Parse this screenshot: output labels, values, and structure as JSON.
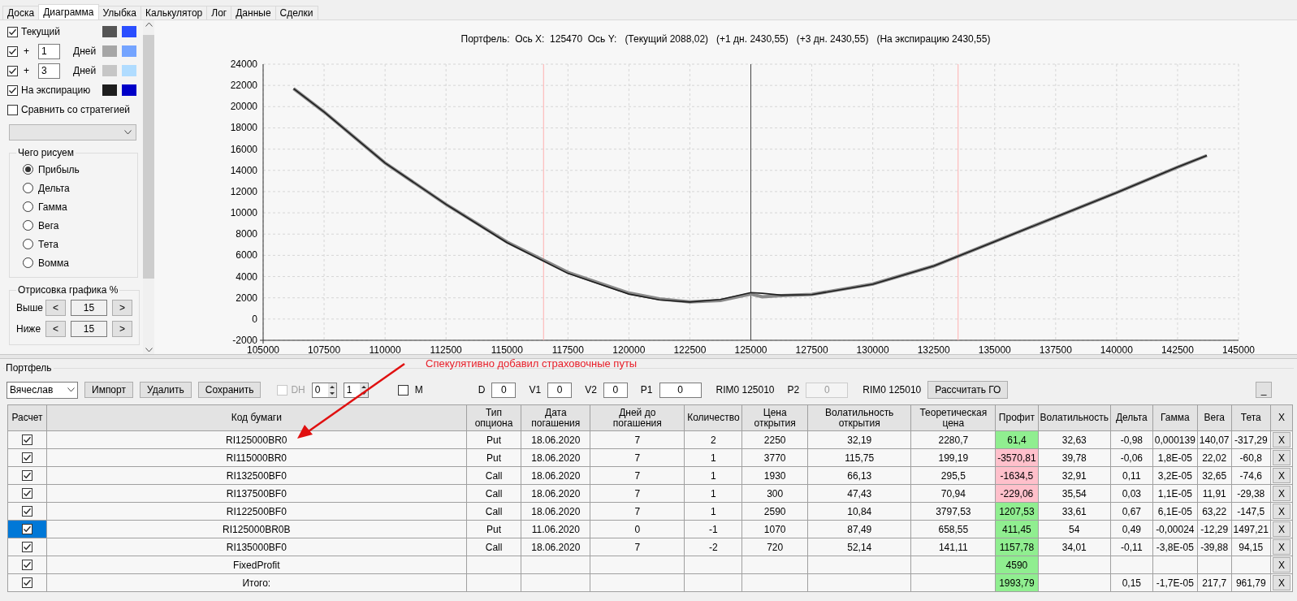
{
  "tabs": [
    {
      "label": "Доска",
      "selected": false
    },
    {
      "label": "Диаграмма",
      "selected": true
    },
    {
      "label": "Улыбка",
      "selected": false
    },
    {
      "label": "Калькулятор",
      "selected": false
    },
    {
      "label": "Лог",
      "selected": false
    },
    {
      "label": "Данные",
      "selected": false
    },
    {
      "label": "Сделки",
      "selected": false
    }
  ],
  "panel": {
    "curves": [
      {
        "kind": "label",
        "checked": true,
        "label": "Текущий",
        "swatches": [
          {
            "color": "#555555"
          },
          {
            "color": "#2a4eff"
          }
        ]
      },
      {
        "kind": "days",
        "checked": true,
        "prefix": "+",
        "days": "1",
        "unit": "Дней",
        "swatches": [
          {
            "color": "#a6a6a6"
          },
          {
            "color": "#74a4ff"
          }
        ]
      },
      {
        "kind": "days",
        "checked": true,
        "prefix": "+",
        "days": "3",
        "unit": "Дней",
        "swatches": [
          {
            "color": "#c6c6c6"
          },
          {
            "color": "#b0dcff"
          }
        ]
      },
      {
        "kind": "label",
        "checked": true,
        "label": "На экспирацию",
        "swatches": [
          {
            "color": "#1e1e1e"
          },
          {
            "color": "#0000c8"
          }
        ]
      }
    ],
    "compare": {
      "label": "Сравнить со стратегией",
      "checked": false
    },
    "plot_mode": {
      "title": "Чего рисуем",
      "options": [
        {
          "label": "Прибыль",
          "selected": true
        },
        {
          "label": "Дельта",
          "selected": false
        },
        {
          "label": "Гамма",
          "selected": false
        },
        {
          "label": "Вега",
          "selected": false
        },
        {
          "label": "Тета",
          "selected": false
        },
        {
          "label": "Вомма",
          "selected": false
        }
      ]
    },
    "range": {
      "title": "Отрисовка графика %",
      "rows": [
        {
          "label": "Выше",
          "prev": "<",
          "value": "15",
          "next": ">"
        },
        {
          "label": "Ниже",
          "prev": "<",
          "value": "15",
          "next": ">"
        }
      ]
    }
  },
  "chart": {
    "chart_data": {
      "type": "line",
      "title": "Портфель:  Ось X:  125470  Ось Y:   (Текущий 2088,02)   (+1 дн. 2430,55)   (+3 дн. 2430,55)   (На экспирацию 2430,55)",
      "x": [
        106250,
        107500,
        110000,
        112500,
        115000,
        117500,
        120000,
        121250,
        122500,
        123750,
        125000,
        125470,
        126250,
        127500,
        130000,
        132500,
        135000,
        137500,
        140000,
        142500,
        143700
      ],
      "grid": true,
      "series": [
        {
          "color": "#8a8a8a",
          "values": [
            21700,
            19500,
            14700,
            10800,
            7250,
            4400,
            2450,
            1900,
            1620,
            1750,
            2350,
            2100,
            2200,
            2320,
            3300,
            5000,
            7300,
            9600,
            11900,
            14300,
            15400
          ]
        },
        {
          "color": "#1e1e1e",
          "values": [
            21700,
            19500,
            14700,
            10800,
            7200,
            4300,
            2350,
            1800,
            1600,
            1850,
            2500,
            2430,
            2250,
            2300,
            3280,
            5000,
            7300,
            9600,
            11900,
            14300,
            15400
          ]
        }
      ],
      "xlim": [
        105000,
        145000
      ],
      "ylim": [
        -2000,
        24000
      ],
      "xticks": [
        105000,
        107500,
        110000,
        112500,
        115000,
        117500,
        120000,
        122500,
        125000,
        127500,
        130000,
        132500,
        135000,
        137500,
        140000,
        142500,
        145000
      ],
      "yticks": [
        -2000,
        0,
        2000,
        4000,
        6000,
        8000,
        10000,
        12000,
        14000,
        16000,
        18000,
        20000,
        22000,
        24000
      ],
      "ref_lines": [
        {
          "axis": "x",
          "value": 116500,
          "color": "#ffb0b0"
        },
        {
          "axis": "x",
          "value": 125000,
          "color": "#444444"
        },
        {
          "axis": "x",
          "value": 133500,
          "color": "#ffb0b0"
        }
      ]
    }
  },
  "portfolio": {
    "title": "Портфель",
    "annotation": "Спекулятивно добавил страховочные путы",
    "toolbar": {
      "account": "Вячеслав",
      "buttons": [
        "Импорт",
        "Удалить",
        "Сохранить"
      ],
      "dh": {
        "label": "DH",
        "checked": false,
        "disabled": true
      },
      "spinners": [
        "0",
        "1"
      ],
      "m": {
        "label": "M",
        "checked": false
      },
      "params": [
        {
          "label": "D",
          "value": "0",
          "disabled": false
        },
        {
          "label": "V1",
          "value": "0",
          "disabled": false
        },
        {
          "label": "V2",
          "value": "0",
          "disabled": false
        },
        {
          "label": "P1",
          "value": "0",
          "disabled": false,
          "contract": "RIM0 125010"
        },
        {
          "label": "P2",
          "value": "0",
          "disabled": true,
          "contract": "RIM0 125010"
        }
      ],
      "calc_button": "Рассчитать ГО",
      "minimize": "_"
    },
    "table": {
      "columns": [
        "Расчет",
        "Код бумаги",
        "Тип\nопциона",
        "Дата\nпогашения",
        "Дней до\nпогашения",
        "Количество",
        "Цена\nоткрытия",
        "Волатильность\nоткрытия",
        "Теоретическая\nцена",
        "Профит",
        "Волатильность",
        "Дельта",
        "Гамма",
        "Вега",
        "Тета",
        "X"
      ],
      "rows": [
        {
          "checked": true,
          "selected": false,
          "loss": false,
          "cells": [
            null,
            "RI125000BR0",
            "Put",
            "18.06.2020",
            "7",
            "2",
            "2250",
            "32,19",
            "2280,7",
            "61,4",
            "32,63",
            "-0,98",
            "0,000139",
            "140,07",
            "-317,29",
            "X"
          ]
        },
        {
          "checked": true,
          "selected": false,
          "loss": true,
          "cells": [
            null,
            "RI115000BR0",
            "Put",
            "18.06.2020",
            "7",
            "1",
            "3770",
            "115,75",
            "199,19",
            "-3570,81",
            "39,78",
            "-0,06",
            "1,8E-05",
            "22,02",
            "-60,8",
            "X"
          ]
        },
        {
          "checked": true,
          "selected": false,
          "loss": true,
          "cells": [
            null,
            "RI132500BF0",
            "Call",
            "18.06.2020",
            "7",
            "1",
            "1930",
            "66,13",
            "295,5",
            "-1634,5",
            "32,91",
            "0,11",
            "3,2E-05",
            "32,65",
            "-74,6",
            "X"
          ]
        },
        {
          "checked": true,
          "selected": false,
          "loss": true,
          "cells": [
            null,
            "RI137500BF0",
            "Call",
            "18.06.2020",
            "7",
            "1",
            "300",
            "47,43",
            "70,94",
            "-229,06",
            "35,54",
            "0,03",
            "1,1E-05",
            "11,91",
            "-29,38",
            "X"
          ]
        },
        {
          "checked": true,
          "selected": false,
          "loss": false,
          "cells": [
            null,
            "RI122500BF0",
            "Call",
            "18.06.2020",
            "7",
            "1",
            "2590",
            "10,84",
            "3797,53",
            "1207,53",
            "33,61",
            "0,67",
            "6,1E-05",
            "63,22",
            "-147,5",
            "X"
          ]
        },
        {
          "checked": true,
          "selected": true,
          "loss": false,
          "cells": [
            null,
            "RI125000BR0B",
            "Put",
            "11.06.2020",
            "0",
            "-1",
            "1070",
            "87,49",
            "658,55",
            "411,45",
            "54",
            "0,49",
            "-0,00024",
            "-12,29",
            "1497,21",
            "X"
          ]
        },
        {
          "checked": true,
          "selected": false,
          "loss": false,
          "cells": [
            null,
            "RI135000BF0",
            "Call",
            "18.06.2020",
            "7",
            "-2",
            "720",
            "52,14",
            "141,11",
            "1157,78",
            "34,01",
            "-0,11",
            "-3,8E-05",
            "-39,88",
            "94,15",
            "X"
          ]
        },
        {
          "checked": true,
          "selected": false,
          "loss": false,
          "cells": [
            null,
            "FixedProfit",
            null,
            null,
            null,
            null,
            null,
            null,
            null,
            "4590",
            null,
            null,
            null,
            null,
            null,
            "X"
          ]
        },
        {
          "checked": true,
          "selected": false,
          "loss": false,
          "cells": [
            null,
            "Итого:",
            null,
            null,
            null,
            null,
            null,
            null,
            null,
            "1993,79",
            null,
            "0,15",
            "-1,7E-05",
            "217,7",
            "961,79",
            "X"
          ]
        }
      ]
    }
  }
}
